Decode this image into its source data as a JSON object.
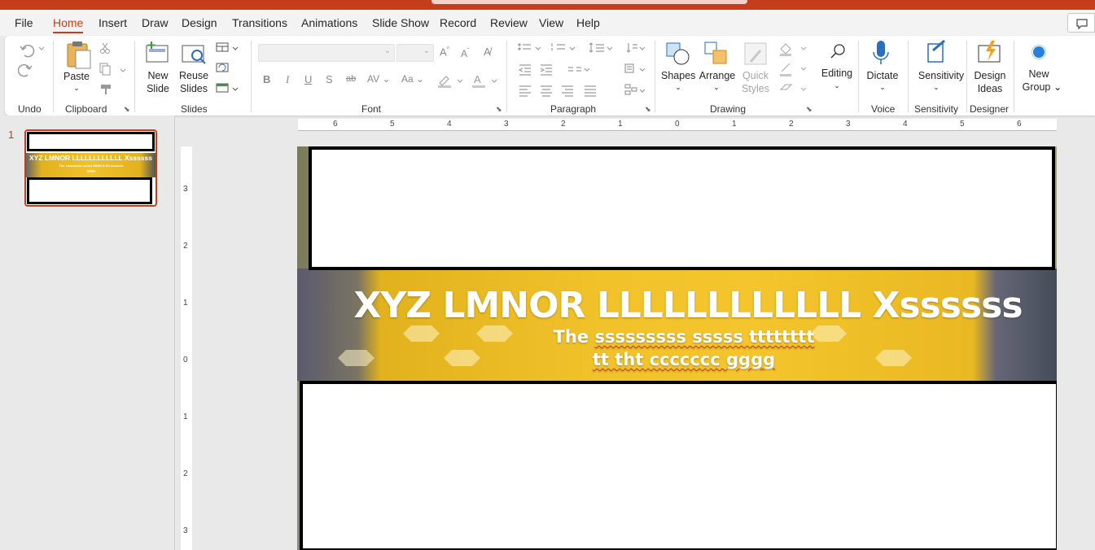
{
  "menu": {
    "tabs": [
      "File",
      "Home",
      "Insert",
      "Draw",
      "Design",
      "Transitions",
      "Animations",
      "Slide Show",
      "Record",
      "Review",
      "View",
      "Help"
    ],
    "active_tab": "Home"
  },
  "ribbon": {
    "groups": {
      "undo": "Undo",
      "clipboard": "Clipboard",
      "slides": "Slides",
      "font": "Font",
      "paragraph": "Paragraph",
      "drawing": "Drawing",
      "voice": "Voice",
      "sensitivity": "Sensitivity",
      "designer": "Designer"
    },
    "buttons": {
      "paste": "Paste",
      "new_slide_1": "New",
      "new_slide_2": "Slide",
      "reuse_1": "Reuse",
      "reuse_2": "Slides",
      "shapes": "Shapes",
      "arrange": "Arrange",
      "quick_styles_1": "Quick",
      "quick_styles_2": "Styles",
      "editing": "Editing",
      "dictate": "Dictate",
      "sensitivity": "Sensitivity",
      "design_ideas_1": "Design",
      "design_ideas_2": "Ideas",
      "new_group_1": "New",
      "new_group_2": "Group"
    },
    "font_name_value": "",
    "font_size_value": ""
  },
  "slide_panel": {
    "slide_number": "1",
    "thumb_title": "XYZ LMNOR LLLLLLLLLLLL Xssssss",
    "thumb_sub": "The sssssssss sssss tttttttt tt tht ccccccc gggg"
  },
  "rulers": {
    "horizontal": [
      "6",
      "5",
      "4",
      "3",
      "2",
      "1",
      "0",
      "1",
      "2",
      "3",
      "4",
      "5",
      "6"
    ],
    "vertical": [
      "3",
      "2",
      "1",
      "0",
      "1",
      "2",
      "3"
    ]
  },
  "slide": {
    "title": "XYZ LMNOR LLLLLLLLLLLL Xssssss",
    "subtitle_line1_a": "The ",
    "subtitle_line1_b": "sssssssss sssss tttttttt",
    "subtitle_line2_a": "tt tht ccccccc gggg"
  },
  "colors": {
    "accent": "#c43e1c",
    "banner_gold": "#f1c22a"
  }
}
